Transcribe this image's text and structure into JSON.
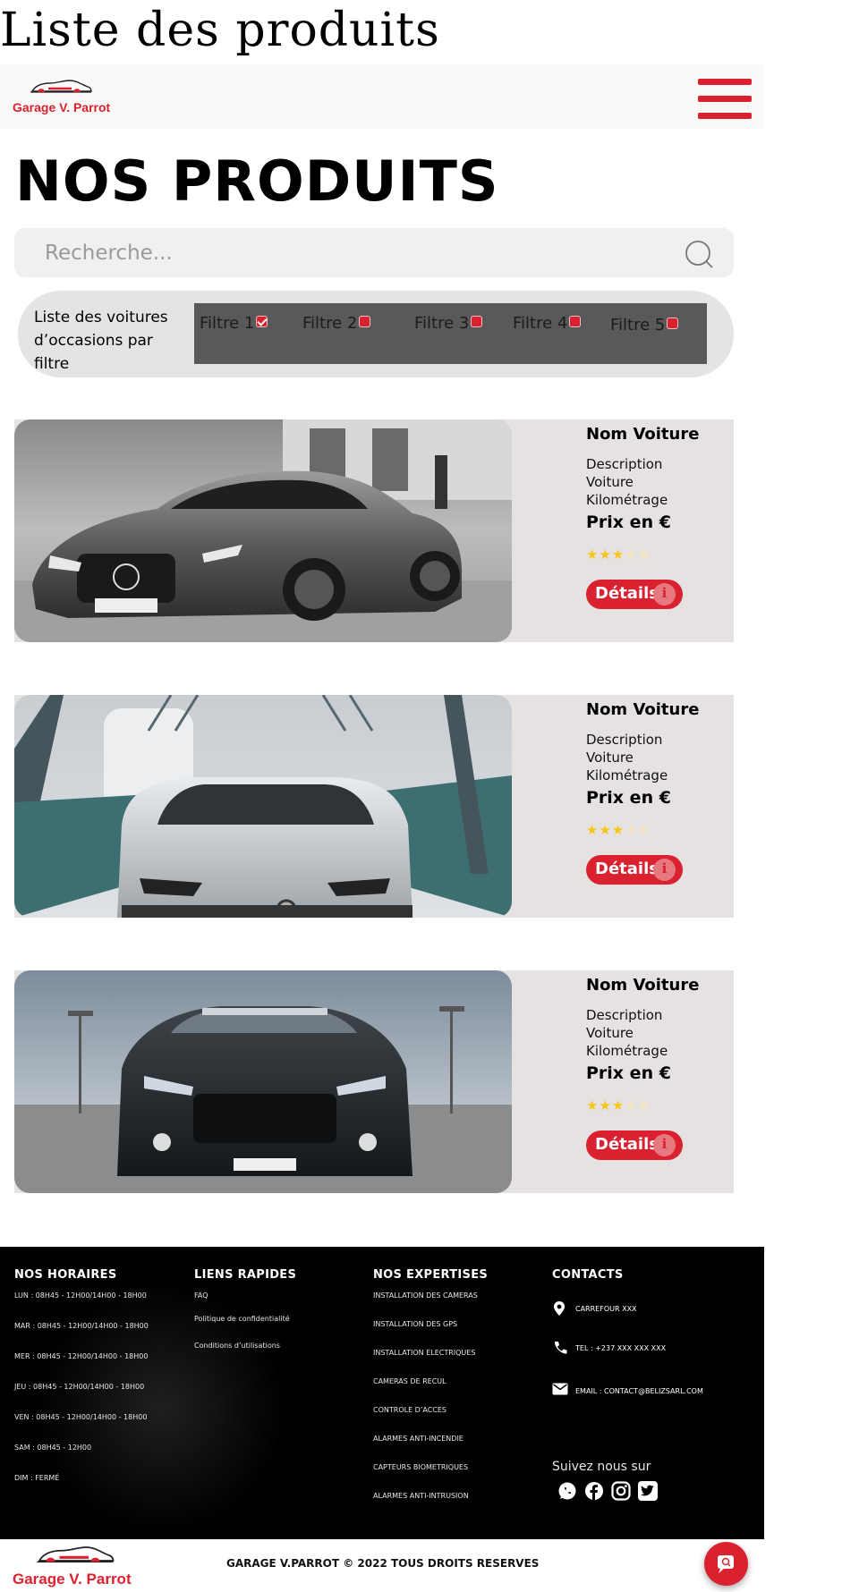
{
  "document": {
    "title": "Liste des produits"
  },
  "header": {
    "logo_text": "Garage V. Parrot",
    "menu_icon": "hamburger-menu-icon",
    "accent_color": "#d9212f"
  },
  "main": {
    "title": "NOS PRODUITS",
    "search": {
      "placeholder": "Recherche...",
      "value": "",
      "icon": "search-icon"
    },
    "filters": {
      "label": "Liste des voitures d’occasions par filtre",
      "items": [
        {
          "label": "Filtre 1",
          "checked": true
        },
        {
          "label": "Filtre 2",
          "checked": false
        },
        {
          "label": "Filtre 3",
          "checked": false
        },
        {
          "label": "Filtre 4",
          "checked": false
        },
        {
          "label": "Filtre 5",
          "checked": false
        }
      ]
    },
    "products": [
      {
        "name": "Nom Voiture",
        "description": "Description Voiture Kilométrage",
        "price": "Prix en €",
        "rating": 3,
        "rating_max": 5,
        "button_label": "Détails",
        "photo": "mercedes-amg-gt-grayscale"
      },
      {
        "name": "Nom Voiture",
        "description": "Description Voiture Kilométrage",
        "price": "Prix en €",
        "rating": 3,
        "rating_max": 5,
        "button_label": "Détails",
        "photo": "volkswagen-golf-white-on-bridge"
      },
      {
        "name": "Nom Voiture",
        "description": "Description Voiture Kilométrage",
        "price": "Prix en €",
        "rating": 3,
        "rating_max": 5,
        "button_label": "Détails",
        "photo": "ford-mustang-dark-front"
      }
    ]
  },
  "footer": {
    "hours": {
      "title": "NOS HORAIRES",
      "lines": [
        "LUN  : 08H45 - 12H00/14H00 - 18H00",
        "MAR : 08H45 - 12H00/14H00 - 18H00",
        "MER : 08H45 - 12H00/14H00 - 18H00",
        "JEU  : 08H45 - 12H00/14H00 - 18H00",
        "VEN  : 08H45 - 12H00/14H00 - 18H00",
        "SAM : 08H45 - 12H00",
        "DIM   : FERMÉ"
      ]
    },
    "links": {
      "title": "LIENS RAPIDES",
      "items": [
        "FAQ",
        "Politique de confidentialité",
        "Conditions d’utilisations"
      ]
    },
    "expertise": {
      "title": "NOS EXPERTISES",
      "items": [
        "INSTALLATION DES CAMERAS",
        "INSTALLATION DES GPS",
        "INSTALLATION ELECTRIQUES",
        "CAMERAS DE RECUL",
        "CONTROLE D’ACCES",
        "ALARMES ANTI-INCENDIE",
        "CAPTEURS BIOMETRIQUES",
        "ALARMES ANTI-INTRUSION"
      ]
    },
    "contacts": {
      "title": "CONTACTS",
      "address": "CARREFOUR XXX",
      "phone": "TEL : +237 XXX XXX XXX",
      "email": "EMAIL : CONTACT@BELIZSARL.COM",
      "follow_label": "Suivez nous sur",
      "socials": [
        "whatsapp-icon",
        "facebook-icon",
        "instagram-icon",
        "twitter-icon"
      ]
    }
  },
  "bottom": {
    "logo_text": "Garage V. Parrot",
    "copyright": "GARAGE V.PARROT © 2022 TOUS DROITS RESERVES",
    "chat_icon": "chat-icon"
  }
}
